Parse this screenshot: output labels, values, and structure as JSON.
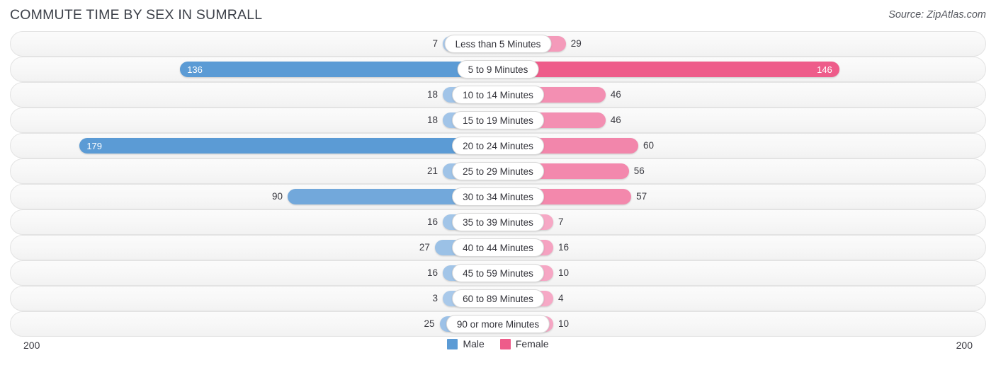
{
  "header": {
    "title": "COMMUTE TIME BY SEX IN SUMRALL",
    "source": "Source: ZipAtlas.com"
  },
  "legend": {
    "male_label": "Male",
    "female_label": "Female",
    "male_color": "#5b9bd5",
    "female_color": "#ee5c8a"
  },
  "axis": {
    "left_max_label": "200",
    "right_max_label": "200",
    "max_value": 200
  },
  "chart_data": {
    "type": "bar",
    "subtype": "diverging-bar",
    "title": "COMMUTE TIME BY SEX IN SUMRALL",
    "xlabel": "",
    "ylabel": "",
    "xlim": [
      200,
      200
    ],
    "grid": true,
    "legend_position": "bottom-center",
    "categories": [
      "Less than 5 Minutes",
      "5 to 9 Minutes",
      "10 to 14 Minutes",
      "15 to 19 Minutes",
      "20 to 24 Minutes",
      "25 to 29 Minutes",
      "30 to 34 Minutes",
      "35 to 39 Minutes",
      "40 to 44 Minutes",
      "45 to 59 Minutes",
      "60 to 89 Minutes",
      "90 or more Minutes"
    ],
    "series": [
      {
        "name": "Male",
        "values": [
          7,
          136,
          18,
          18,
          179,
          21,
          90,
          16,
          27,
          16,
          3,
          25
        ]
      },
      {
        "name": "Female",
        "values": [
          29,
          146,
          46,
          46,
          60,
          56,
          57,
          7,
          16,
          10,
          4,
          10
        ]
      }
    ]
  },
  "rows": [
    {
      "label": "Less than 5 Minutes",
      "male": 7,
      "female": 29,
      "male_text": "7",
      "female_text": "29"
    },
    {
      "label": "5 to 9 Minutes",
      "male": 136,
      "female": 146,
      "male_text": "136",
      "female_text": "146"
    },
    {
      "label": "10 to 14 Minutes",
      "male": 18,
      "female": 46,
      "male_text": "18",
      "female_text": "46"
    },
    {
      "label": "15 to 19 Minutes",
      "male": 18,
      "female": 46,
      "male_text": "18",
      "female_text": "46"
    },
    {
      "label": "20 to 24 Minutes",
      "male": 179,
      "female": 60,
      "male_text": "179",
      "female_text": "60"
    },
    {
      "label": "25 to 29 Minutes",
      "male": 21,
      "female": 56,
      "male_text": "21",
      "female_text": "56"
    },
    {
      "label": "30 to 34 Minutes",
      "male": 90,
      "female": 57,
      "male_text": "90",
      "female_text": "57"
    },
    {
      "label": "35 to 39 Minutes",
      "male": 16,
      "female": 7,
      "male_text": "16",
      "female_text": "7"
    },
    {
      "label": "40 to 44 Minutes",
      "male": 27,
      "female": 16,
      "male_text": "27",
      "female_text": "16"
    },
    {
      "label": "45 to 59 Minutes",
      "male": 16,
      "female": 10,
      "male_text": "16",
      "female_text": "10"
    },
    {
      "label": "60 to 89 Minutes",
      "male": 3,
      "female": 4,
      "male_text": "3",
      "female_text": "4"
    },
    {
      "label": "90 or more Minutes",
      "male": 25,
      "female": 10,
      "male_text": "25",
      "female_text": "10"
    }
  ]
}
